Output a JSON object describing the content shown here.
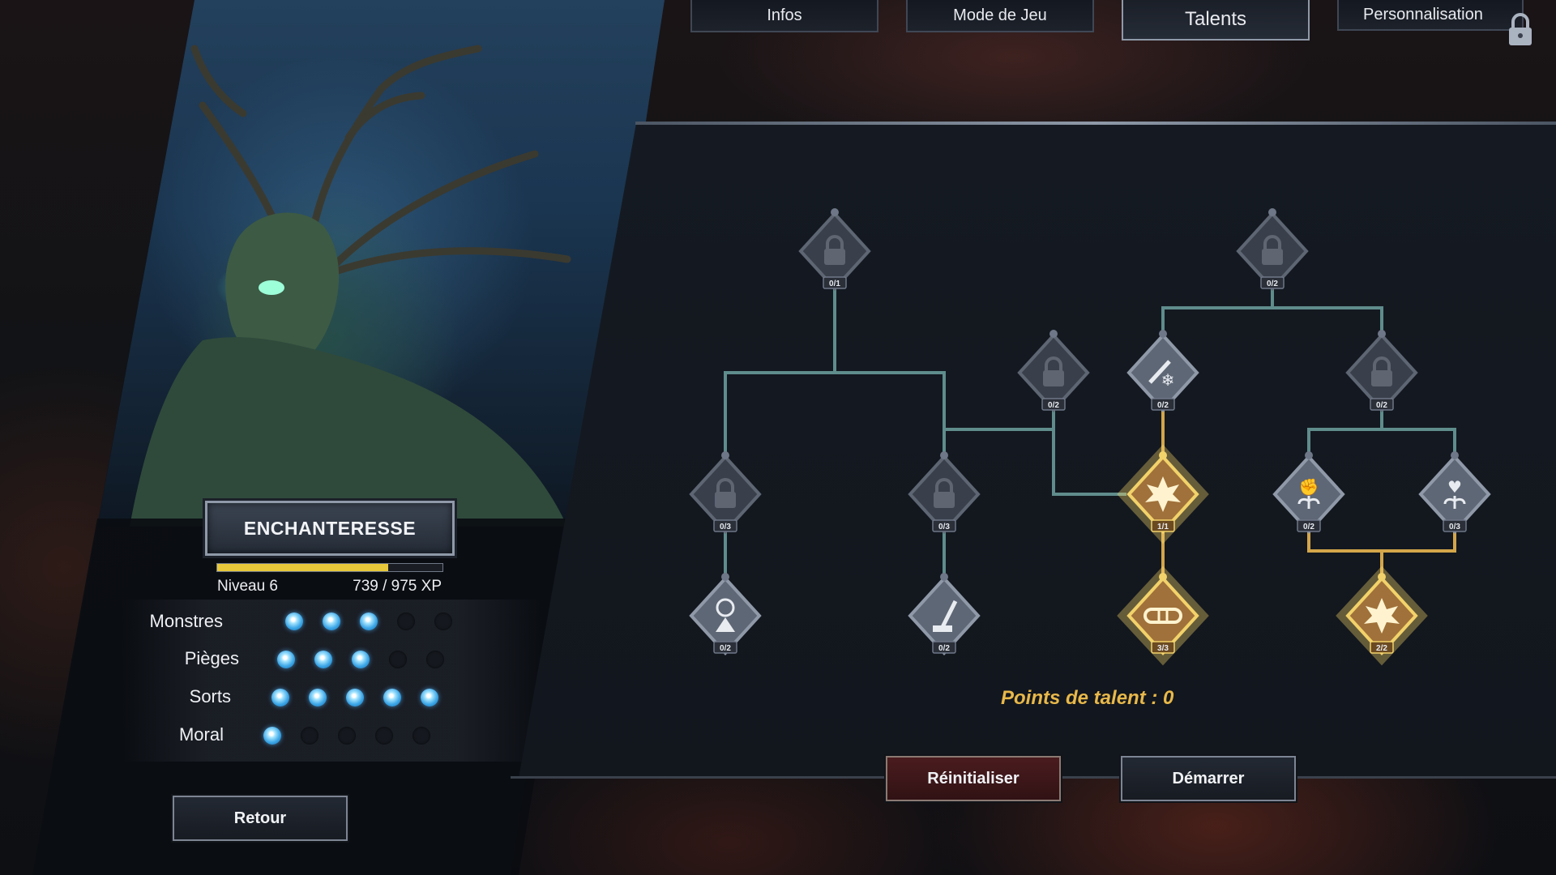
{
  "tabs": [
    {
      "label": "Infos",
      "active": false
    },
    {
      "label": "Mode de Jeu",
      "active": false
    },
    {
      "label": "Talents",
      "active": true
    },
    {
      "label": "Personnalisation",
      "active": false,
      "locked": true
    }
  ],
  "hero": {
    "name": "ENCHANTERESSE",
    "level_label": "Niveau 6",
    "xp_label": "739 / 975 XP",
    "xp_current": 739,
    "xp_max": 975
  },
  "stats": [
    {
      "label": "Monstres",
      "filled": 3,
      "total": 5
    },
    {
      "label": "Pièges",
      "filled": 3,
      "total": 5
    },
    {
      "label": "Sorts",
      "filled": 5,
      "total": 5
    },
    {
      "label": "Moral",
      "filled": 1,
      "total": 5
    }
  ],
  "buttons": {
    "back": "Retour",
    "reset": "Réinitialiser",
    "start": "Démarrer"
  },
  "talent_points_label": "Points de talent : 0",
  "talent_nodes": [
    {
      "id": "n1",
      "counter": "0/1",
      "state": "locked",
      "icon": "lock-icon"
    },
    {
      "id": "n2",
      "counter": "0/2",
      "state": "locked",
      "icon": "lock-icon"
    },
    {
      "id": "n3",
      "counter": "0/2",
      "state": "locked",
      "icon": "lock-icon"
    },
    {
      "id": "n4",
      "counter": "0/2",
      "state": "available",
      "icon": "frost-wand-icon"
    },
    {
      "id": "n5",
      "counter": "0/2",
      "state": "locked",
      "icon": "lock-icon"
    },
    {
      "id": "n6",
      "counter": "0/3",
      "state": "locked",
      "icon": "lock-icon"
    },
    {
      "id": "n7",
      "counter": "0/3",
      "state": "locked",
      "icon": "lock-icon"
    },
    {
      "id": "n8",
      "counter": "1/1",
      "state": "maxed",
      "icon": "frost-burst-icon"
    },
    {
      "id": "n9",
      "counter": "0/2",
      "state": "available",
      "icon": "fist-sprout-icon"
    },
    {
      "id": "n10",
      "counter": "0/3",
      "state": "available",
      "icon": "heart-sprout-icon"
    },
    {
      "id": "n11",
      "counter": "0/2",
      "state": "available",
      "icon": "hourglass-trap-icon"
    },
    {
      "id": "n12",
      "counter": "0/2",
      "state": "available",
      "icon": "lever-icon"
    },
    {
      "id": "n13",
      "counter": "3/3",
      "state": "maxed",
      "icon": "chain-icon"
    },
    {
      "id": "n14",
      "counter": "2/2",
      "state": "maxed",
      "icon": "beast-icon"
    }
  ],
  "colors": {
    "gold": "#e8b84a",
    "link_inactive": "#5f8c8c",
    "link_active": "#d4a64a",
    "pip_on": "#3aa5e6"
  }
}
